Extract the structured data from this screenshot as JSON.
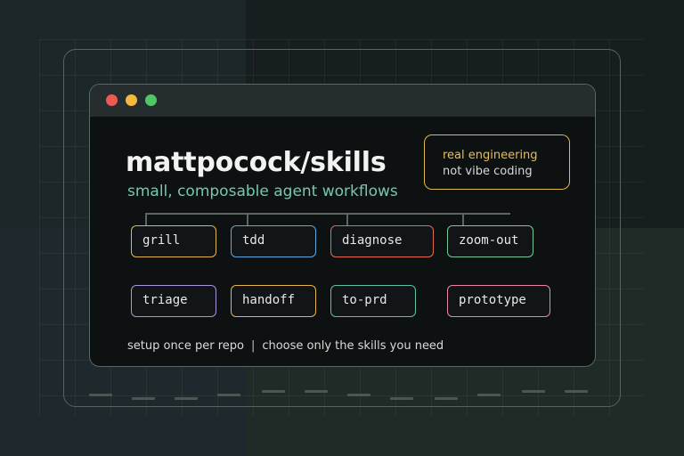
{
  "header": {
    "title": "mattpocock/skills",
    "subtitle": "small, composable agent workflows"
  },
  "callout": {
    "line1": "real engineering",
    "line2": "not vibe coding",
    "color": "#e2b94c"
  },
  "skills": [
    {
      "label": "grill",
      "color": "#e3b54a"
    },
    {
      "label": "tdd",
      "color": "#5ea7df"
    },
    {
      "label": "diagnose",
      "color": "#e46a4e"
    },
    {
      "label": "zoom-out",
      "color": "#78c89a"
    },
    {
      "label": "triage",
      "color": "#a795dd"
    },
    {
      "label": "handoff",
      "color": "#e3b54a"
    },
    {
      "label": "to-prd",
      "color": "#5fbfa8"
    },
    {
      "label": "prototype",
      "color": "#e986a6"
    }
  ],
  "footer": {
    "left": "setup once per repo",
    "separator": "|",
    "right": "choose only the skills you need"
  },
  "window_controls": [
    "close-dot",
    "minimize-dot",
    "maximize-dot"
  ]
}
